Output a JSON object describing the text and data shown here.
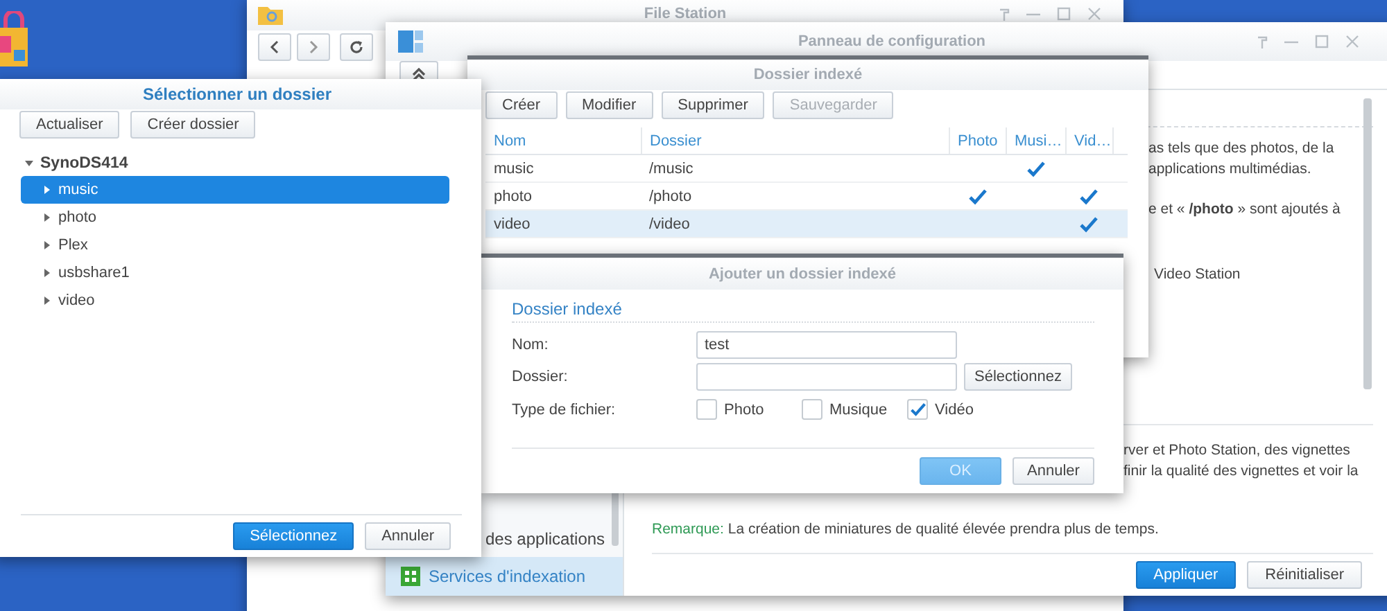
{
  "file_station": {
    "title": "File Station"
  },
  "control_panel": {
    "title": "Panneau de configuration",
    "sidebar": [
      {
        "label": "des applications",
        "selected": false
      },
      {
        "label": "Services d'indexation",
        "selected": true
      }
    ],
    "lines": [
      {
        "text": "as tels que des photos, de la",
        "kind": "cut"
      },
      {
        "text": "applications multimédias.",
        "kind": "cut"
      },
      {
        "text": "e et « **/photo** » sont ajoutés à",
        "kind": "cut"
      },
      {
        "text": "Video Station",
        "kind": "item"
      },
      {
        "text": "rver et Photo Station, des vignettes",
        "kind": "lower"
      },
      {
        "text": "finir la qualité des vignettes et voir la",
        "kind": "lower"
      }
    ],
    "note_label": "Remarque:",
    "note": "La création de miniatures de qualité élevée prendra plus de temps.",
    "buttons": [
      {
        "label": "Appliquer",
        "kind": "primary",
        "disabled": false
      },
      {
        "label": "Réinitialiser",
        "kind": "default",
        "disabled": false
      }
    ]
  },
  "indexed_folders": {
    "title": "Dossier indexé",
    "toolbar": [
      {
        "label": "Créer",
        "disabled": false
      },
      {
        "label": "Modifier",
        "disabled": false
      },
      {
        "label": "Supprimer",
        "disabled": false
      },
      {
        "label": "Sauvegarder",
        "disabled": true
      }
    ],
    "columns": [
      "Nom",
      "Dossier",
      "Photo",
      "Musi…",
      "Vid…"
    ],
    "rows": [
      {
        "name": "music",
        "folder": "/music",
        "photo": false,
        "music": true,
        "video": false,
        "selected": false
      },
      {
        "name": "photo",
        "folder": "/photo",
        "photo": true,
        "music": false,
        "video": true,
        "selected": false
      },
      {
        "name": "video",
        "folder": "/video",
        "photo": false,
        "music": false,
        "video": true,
        "selected": true
      }
    ]
  },
  "add_dialog": {
    "title": "Ajouter un dossier indexé",
    "section": "Dossier indexé",
    "name_label": "Nom:",
    "name_value": "test",
    "folder_label": "Dossier:",
    "folder_button": "Sélectionnez",
    "type_label": "Type de fichier:",
    "types": [
      {
        "label": "Photo",
        "checked": false
      },
      {
        "label": "Musique",
        "checked": false
      },
      {
        "label": "Vidéo",
        "checked": true
      }
    ],
    "buttons": [
      {
        "label": "OK",
        "kind": "primary",
        "disabled": true
      },
      {
        "label": "Annuler",
        "kind": "default",
        "disabled": false
      }
    ]
  },
  "select_dialog": {
    "title": "Sélectionner un dossier",
    "toolbar": [
      "Actualiser",
      "Créer dossier"
    ],
    "tree": {
      "label": "SynoDS414",
      "expanded": true,
      "children": [
        {
          "label": "music",
          "selected": true,
          "expanded": false
        },
        {
          "label": "photo",
          "selected": false,
          "expanded": false
        },
        {
          "label": "Plex",
          "selected": false,
          "expanded": false
        },
        {
          "label": "usbshare1",
          "selected": false,
          "expanded": false
        },
        {
          "label": "video",
          "selected": false,
          "expanded": false
        }
      ]
    },
    "buttons": [
      {
        "label": "Sélectionnez",
        "kind": "primary",
        "disabled": false
      },
      {
        "label": "Annuler",
        "kind": "default",
        "disabled": false
      }
    ]
  }
}
